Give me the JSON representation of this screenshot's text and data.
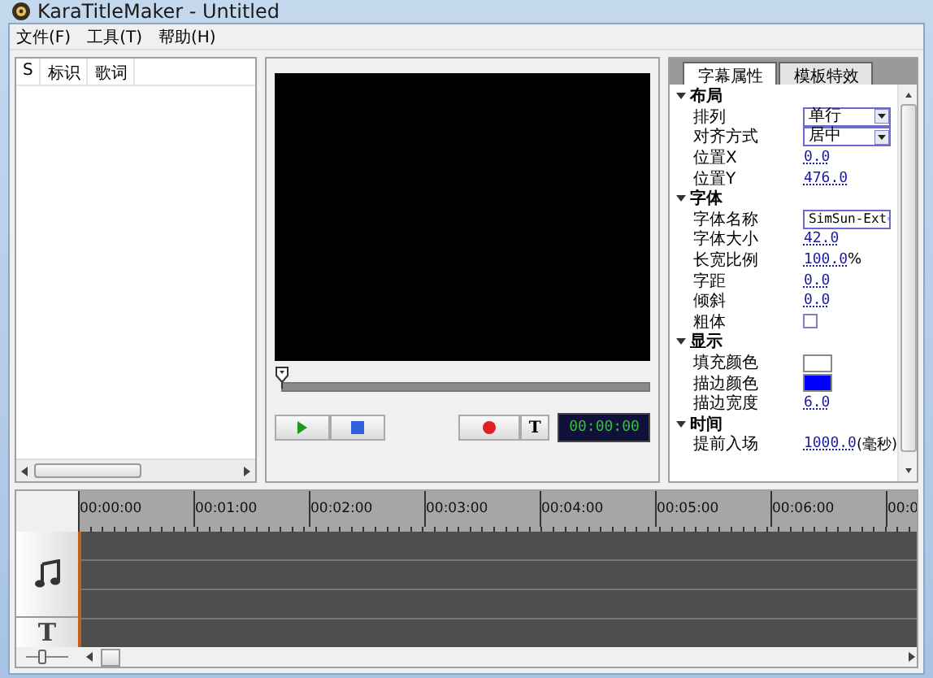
{
  "window": {
    "title": "KaraTitleMaker - Untitled"
  },
  "menu": [
    "文件(F)",
    "工具(T)",
    "帮助(H)"
  ],
  "list": {
    "columns": [
      "S",
      "标识",
      "歌词"
    ]
  },
  "player": {
    "position": {
      "level": 0
    },
    "time": "00:00:00",
    "buttons": [
      {
        "kind": "play"
      },
      {
        "kind": "stop"
      },
      {
        "kind": "record"
      },
      {
        "kind": "text",
        "label": "T"
      }
    ]
  },
  "properties": {
    "tabs": [
      {
        "label": "字幕属性",
        "selected": true
      },
      {
        "label": "模板特效",
        "selected": false
      }
    ],
    "sections": [
      {
        "title": "布局",
        "expanded": true,
        "rows": [
          {
            "label": "排列",
            "kind": "dropdown",
            "value": "单行"
          },
          {
            "label": "对齐方式",
            "kind": "dropdown",
            "value": "居中"
          },
          {
            "label": "位置X",
            "kind": "number",
            "value": "0.0"
          },
          {
            "label": "位置Y",
            "kind": "number",
            "value": "476.0"
          }
        ]
      },
      {
        "title": "字体",
        "expanded": true,
        "rows": [
          {
            "label": "字体名称",
            "kind": "dropdown",
            "value": "SimSun-Ext"
          },
          {
            "label": "字体大小",
            "kind": "number",
            "value": "42.0"
          },
          {
            "label": "长宽比例",
            "kind": "number",
            "value": "100.0",
            "unit": "%"
          },
          {
            "label": "字距",
            "kind": "number",
            "value": "0.0"
          },
          {
            "label": "倾斜",
            "kind": "number",
            "value": "0.0"
          },
          {
            "label": "粗体",
            "kind": "checkbox",
            "checked": false
          }
        ]
      },
      {
        "title": "显示",
        "expanded": true,
        "rows": [
          {
            "label": "填充颜色",
            "kind": "color",
            "color": "#ffffff"
          },
          {
            "label": "描边颜色",
            "kind": "color",
            "color": "#0000ff"
          },
          {
            "label": "描边宽度",
            "kind": "number",
            "value": "6.0"
          }
        ]
      },
      {
        "title": "时间",
        "expanded": true,
        "rows": [
          {
            "label": "提前入场",
            "kind": "number",
            "value": "1000.0",
            "unit": "(毫秒)"
          }
        ]
      }
    ]
  },
  "timeline": {
    "ticks": [
      "00:00:00",
      "00:01:00",
      "00:02:00",
      "00:03:00",
      "00:04:00",
      "00:05:00",
      "00:06:00",
      "00:0"
    ],
    "tracks": [
      {
        "kind": "audio"
      },
      {
        "kind": "text",
        "label": "T"
      }
    ]
  }
}
